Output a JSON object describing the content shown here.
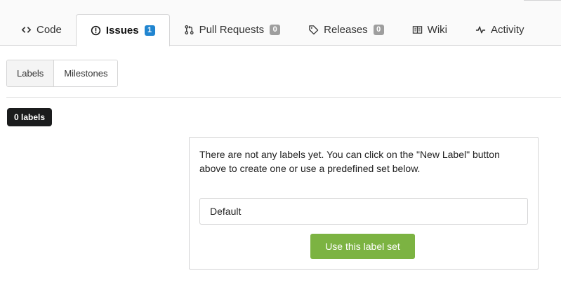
{
  "tabs": [
    {
      "label": "Code",
      "icon": "code-icon"
    },
    {
      "label": "Issues",
      "icon": "issue-icon",
      "badge": "1",
      "active": true
    },
    {
      "label": "Pull Requests",
      "icon": "pull-request-icon",
      "badge": "0"
    },
    {
      "label": "Releases",
      "icon": "tag-icon",
      "badge": "0"
    },
    {
      "label": "Wiki",
      "icon": "book-icon"
    },
    {
      "label": "Activity",
      "icon": "pulse-icon"
    }
  ],
  "subnav": {
    "labels": "Labels",
    "milestones": "Milestones"
  },
  "count_label": "0 labels",
  "empty_panel": {
    "message": "There are not any labels yet. You can click on the \"New Label\" button above to create one or use a predefined set below.",
    "selected_set": "Default",
    "use_button": "Use this label set"
  },
  "colors": {
    "badge_active": "#2185d0",
    "badge_default": "#9e9e9e",
    "button_green": "#7cb342",
    "count_label_bg": "#1b1c1d"
  }
}
